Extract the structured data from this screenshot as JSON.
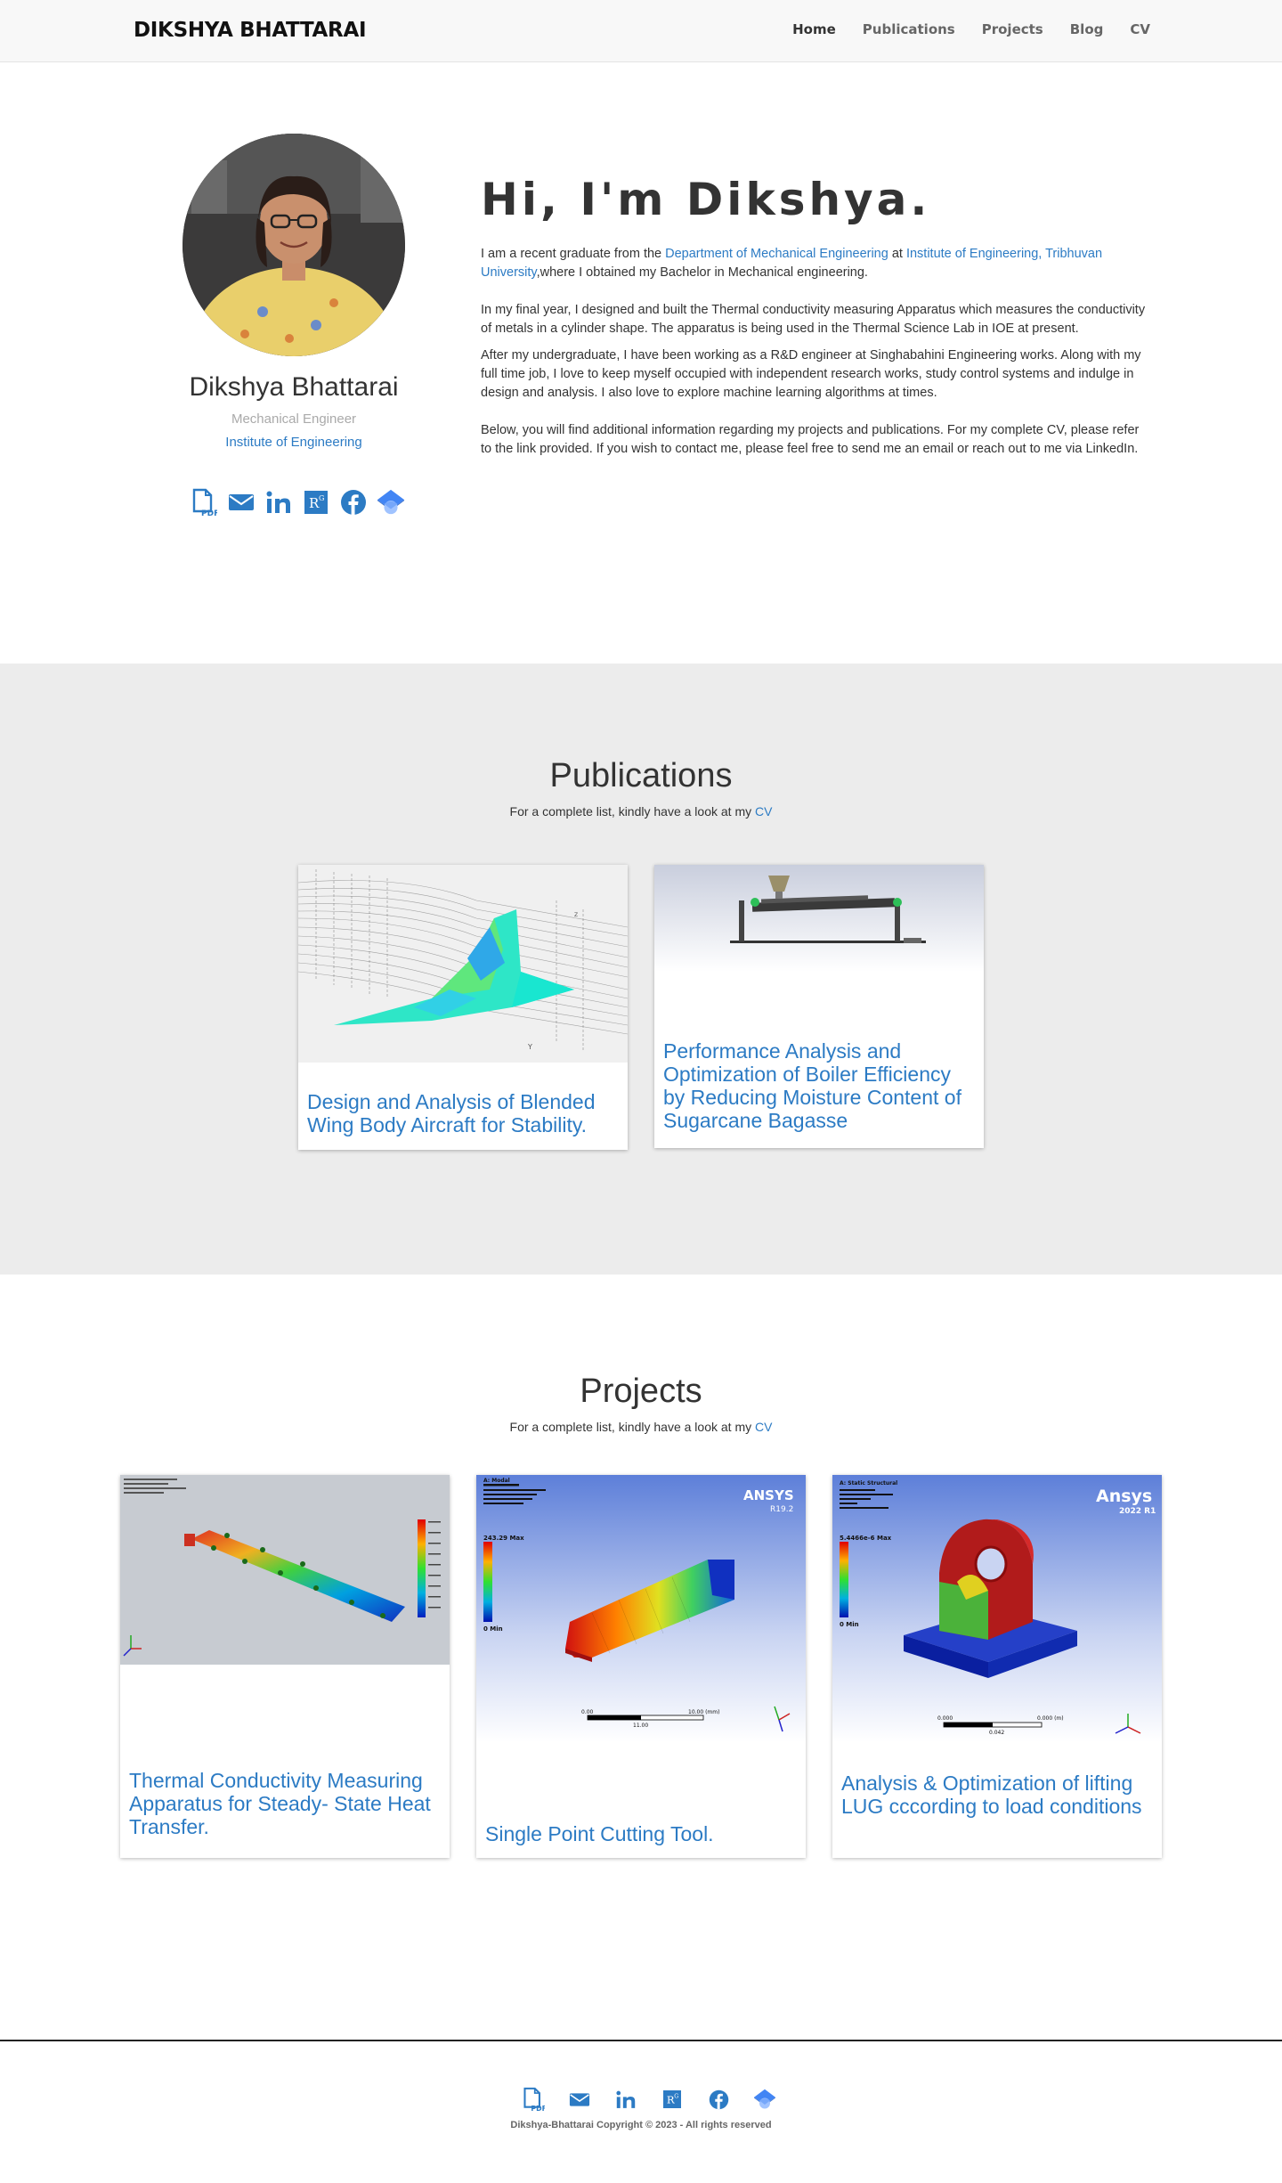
{
  "nav": {
    "brand": "DIKSHYA BHATTARAI",
    "links": [
      "Home",
      "Publications",
      "Projects",
      "Blog",
      "CV"
    ]
  },
  "hero": {
    "name": "Dikshya Bhattarai",
    "role": "Mechanical Engineer",
    "institution": "Institute of Engineering",
    "greeting": "Hi, I'm Dikshya.",
    "p1_a": "I am a recent graduate from the ",
    "p1_link1": "Department of Mechanical Engineering",
    "p1_b": " at ",
    "p1_link2": "Institute of Engineering, Tribhuvan University",
    "p1_c": ",where I obtained my Bachelor in Mechanical engineering.",
    "p2": "In my final year, I designed and built the Thermal conductivity measuring Apparatus which measures the conductivity of metals in a cylinder shape. The apparatus is being used in the Thermal Science Lab in IOE at present.",
    "p3": "After my undergraduate, I have been working as a R&D engineer at Singhabahini Engineering works. Along with my full time job, I love to keep myself occupied with independent research works, study control systems and indulge in design and analysis. I also love to explore machine learning algorithms at times.",
    "p4": "Below, you will find additional information regarding my projects and publications. For my complete CV, please refer to the link provided. If you wish to contact me, please feel free to send me an email or reach out to me via LinkedIn."
  },
  "social_icons": [
    "pdf-cv-icon",
    "email-icon",
    "linkedin-icon",
    "researchgate-icon",
    "facebook-icon",
    "google-scholar-icon"
  ],
  "colors": {
    "accent": "#2c7bc4",
    "section_bg": "#ececec",
    "navbar_bg": "#f8f8f8"
  },
  "publications": {
    "title": "Publications",
    "subtitle_prefix": "For a complete list, kindly have a look at my ",
    "subtitle_link": "CV",
    "cards": [
      {
        "title": "Design and Analysis of Blended Wing Body Aircraft for Stability."
      },
      {
        "title": "Performance Analysis and Optimization of Boiler Efficiency by Reducing Moisture Content of Sugarcane Bagasse"
      }
    ]
  },
  "projects": {
    "title": "Projects",
    "subtitle_prefix": "For a complete list, kindly have a look at my ",
    "subtitle_link": "CV",
    "cards": [
      {
        "title": "Thermal Conductivity Measuring Apparatus for Steady- State Heat Transfer."
      },
      {
        "title": "Single Point Cutting Tool.",
        "brand": "ANSYS",
        "version": "R19.2",
        "analysis": "A: Modal",
        "max_label": "243.29 Max",
        "min_label": "0 Min",
        "scale_a": "0.00",
        "scale_b": "10.00 (mm)",
        "scale_c": "11.00"
      },
      {
        "title": "Analysis & Optimization of lifting LUG cccording to load conditions",
        "brand": "Ansys",
        "version": "2022 R1",
        "analysis": "A: Static Structural",
        "max_label": "5.4466e-6 Max",
        "min_label": "0 Min",
        "scale_a": "0.000",
        "scale_b": "0.000 (m)",
        "scale_c": "0.042"
      }
    ]
  },
  "footer": {
    "copyright": "Dikshya-Bhattarai Copyright © 2023 - All rights reserved"
  }
}
